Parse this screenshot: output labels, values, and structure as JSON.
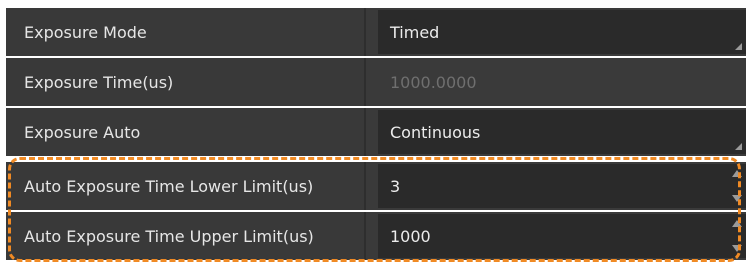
{
  "properties": [
    {
      "label": "Exposure Mode",
      "value": "Timed",
      "control": "dropdown",
      "disabled": false
    },
    {
      "label": "Exposure Time(us)",
      "value": "1000.0000",
      "control": "text",
      "disabled": true
    },
    {
      "label": "Exposure Auto",
      "value": "Continuous",
      "control": "dropdown",
      "disabled": false
    },
    {
      "label": "Auto Exposure Time Lower Limit(us)",
      "value": "3",
      "control": "spinner",
      "disabled": false
    },
    {
      "label": "Auto Exposure Time Upper Limit(us)",
      "value": "1000",
      "control": "spinner",
      "disabled": false
    }
  ],
  "colors": {
    "highlight": "#f08a24",
    "row_background": "#3a3a3a",
    "field_background": "#2a2a2a",
    "label_text": "#e6e6e6",
    "disabled_text": "#6f6f6f"
  }
}
